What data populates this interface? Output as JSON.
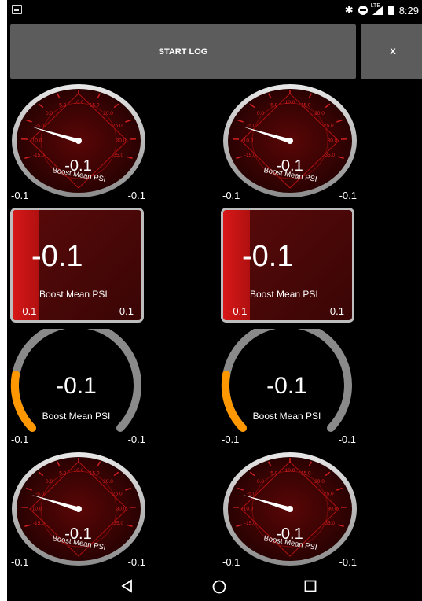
{
  "statusbar": {
    "time": "8:29",
    "network": "LTE",
    "icons": [
      "image-icon",
      "bluetooth-icon",
      "do-not-disturb-icon",
      "signal-icon",
      "battery-icon"
    ]
  },
  "toolbar": {
    "start_log_label": "START LOG",
    "close_label": "X"
  },
  "gauges": [
    {
      "style": "dial",
      "value": "-0.1",
      "label": "Boost Mean PSI",
      "min": "-0.1",
      "max": "-0.1"
    },
    {
      "style": "dial",
      "value": "-0.1",
      "label": "Boost Mean PSI",
      "min": "-0.1",
      "max": "-0.1"
    },
    {
      "style": "bar",
      "value": "-0.1",
      "label": "Boost Mean PSI",
      "min": "-0.1",
      "max": "-0.1"
    },
    {
      "style": "bar",
      "value": "-0.1",
      "label": "Boost Mean PSI",
      "min": "-0.1",
      "max": "-0.1"
    },
    {
      "style": "arc",
      "value": "-0.1",
      "label": "Boost Mean PSI",
      "min": "-0.1",
      "max": "-0.1"
    },
    {
      "style": "arc",
      "value": "-0.1",
      "label": "Boost Mean PSI",
      "min": "-0.1",
      "max": "-0.1"
    },
    {
      "style": "dial",
      "value": "-0.1",
      "label": "Boost Mean PSI",
      "min": "-0.1",
      "max": "-0.1"
    },
    {
      "style": "dial",
      "value": "-0.1",
      "label": "Boost Mean PSI",
      "min": "-0.1",
      "max": "-0.1"
    }
  ],
  "dial_ticks": [
    "-15.0",
    "-10.0",
    "-5.0",
    "0.0",
    "5.0",
    "10.0",
    "15.0",
    "20.0",
    "25.0",
    "30.0",
    "35.0"
  ],
  "navbar": {
    "buttons": [
      "back-icon",
      "home-icon",
      "recents-icon"
    ]
  },
  "colors": {
    "toolbar_button": "#5c5c5c",
    "gauge_red": "#8b0000",
    "bar_fill": "#d81818",
    "arc_track": "#8a8a8a",
    "arc_fill": "#ff9800",
    "bezel": "#c8c8c8"
  }
}
